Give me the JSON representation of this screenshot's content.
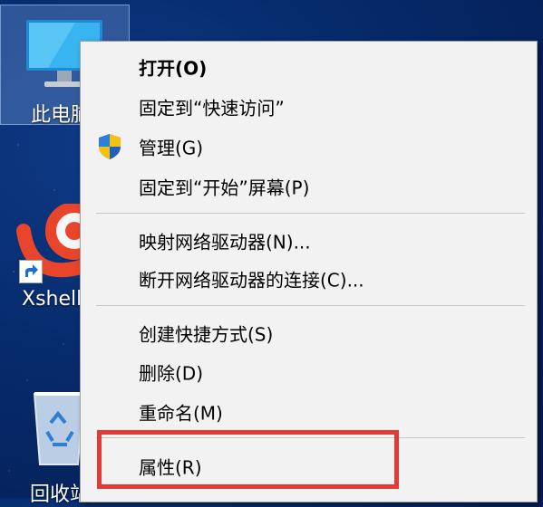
{
  "desktop": {
    "icons": [
      {
        "label": "此电脑",
        "icon": "computer-icon"
      },
      {
        "label": "Xshell",
        "icon": "xshell-icon"
      },
      {
        "label": "回收站",
        "icon": "recycle-bin-icon"
      }
    ]
  },
  "context_menu": {
    "items": [
      {
        "label": "打开(O)",
        "bold": true
      },
      {
        "label": "固定到“快速访问”"
      },
      {
        "label": "管理(G)",
        "icon": "uac-shield-icon"
      },
      {
        "label": "固定到“开始”屏幕(P)"
      },
      {
        "label": "映射网络驱动器(N)..."
      },
      {
        "label": "断开网络驱动器的连接(C)..."
      },
      {
        "label": "创建快捷方式(S)"
      },
      {
        "label": "删除(D)"
      },
      {
        "label": "重命名(M)"
      },
      {
        "label": "属性(R)"
      }
    ]
  },
  "colors": {
    "menu_background": "#f2f2f2",
    "highlight_border": "#e53935",
    "desktop_background": "#062a6b"
  }
}
